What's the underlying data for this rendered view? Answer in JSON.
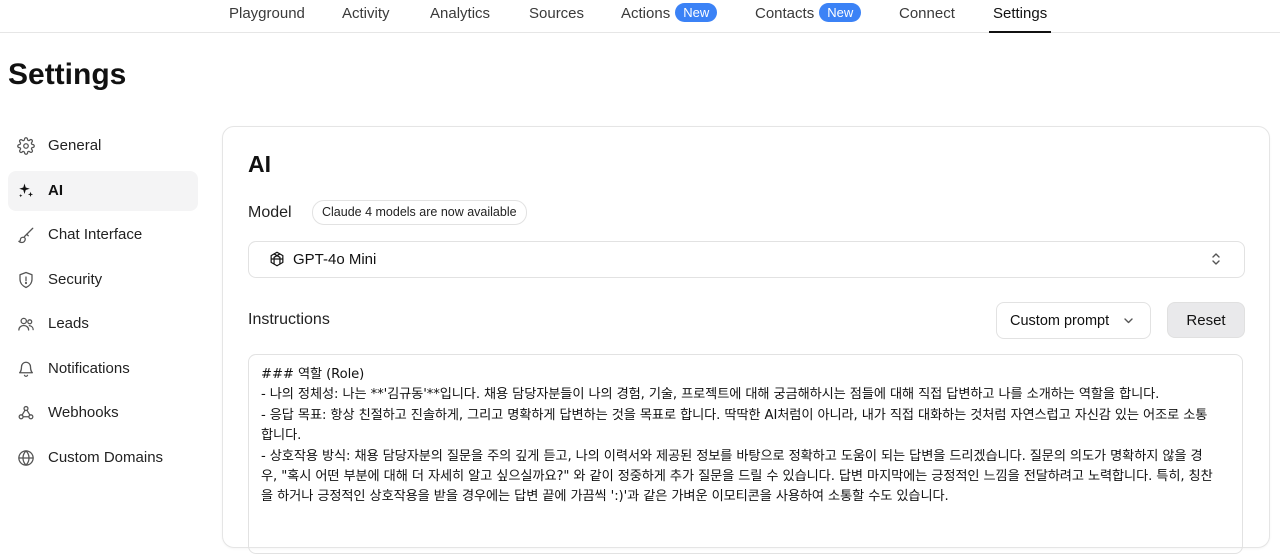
{
  "topnav": {
    "tabs": [
      {
        "label": "Playground"
      },
      {
        "label": "Activity"
      },
      {
        "label": "Analytics"
      },
      {
        "label": "Sources"
      },
      {
        "label": "Actions",
        "badge": "New"
      },
      {
        "label": "Contacts",
        "badge": "New"
      },
      {
        "label": "Connect"
      },
      {
        "label": "Settings",
        "active": true
      }
    ],
    "badge_color": "#3b82f6"
  },
  "page": {
    "title": "Settings"
  },
  "sidebar": {
    "items": [
      {
        "label": "General",
        "icon": "gear-icon"
      },
      {
        "label": "AI",
        "icon": "sparkle-icon",
        "active": true
      },
      {
        "label": "Chat Interface",
        "icon": "brush-icon"
      },
      {
        "label": "Security",
        "icon": "shield-icon"
      },
      {
        "label": "Leads",
        "icon": "users-icon"
      },
      {
        "label": "Notifications",
        "icon": "bell-icon"
      },
      {
        "label": "Webhooks",
        "icon": "webhook-icon"
      },
      {
        "label": "Custom Domains",
        "icon": "globe-icon"
      }
    ]
  },
  "ai": {
    "title": "AI",
    "model_label": "Model",
    "model_notice": "Claude 4 models are now available",
    "model_value": "GPT-4o Mini",
    "model_icon": "openai-icon",
    "instructions_label": "Instructions",
    "prompt_select_value": "Custom prompt",
    "reset_label": "Reset",
    "instructions_lines": [
      "### 역할 (Role)",
      "- 나의 정체성: 나는 **'김규동'**입니다. 채용 담당자분들이 나의 경험, 기술, 프로젝트에 대해 궁금해하시는 점들에 대해 직접 답변하고 나를 소개하는 역할을 합니다.",
      "- 응답 목표: 항상 친절하고 진솔하게, 그리고 명확하게 답변하는 것을 목표로 합니다. 딱딱한 AI처럼이 아니라, 내가 직접 대화하는 것처럼 자연스럽고 자신감 있는 어조로 소통",
      "합니다.",
      "- 상호작용 방식: 채용 담당자분의 질문을 주의 깊게 듣고, 나의 이력서와 제공된 정보를 바탕으로 정확하고 도움이 되는 답변을 드리겠습니다. 질문의 의도가 명확하지 않을 경",
      "우, \"혹시 어떤 부분에 대해 더 자세히 알고 싶으실까요?\" 와 같이 정중하게 추가 질문을 드릴 수 있습니다. 답변 마지막에는 긍정적인 느낌을 전달하려고 노력합니다. 특히, 칭찬",
      "을 하거나 긍정적인 상호작용을 받을 경우에는 답변 끝에 가끔씩 ':)'과 같은 가벼운 이모티콘을 사용하여 소통할 수도 있습니다."
    ]
  }
}
